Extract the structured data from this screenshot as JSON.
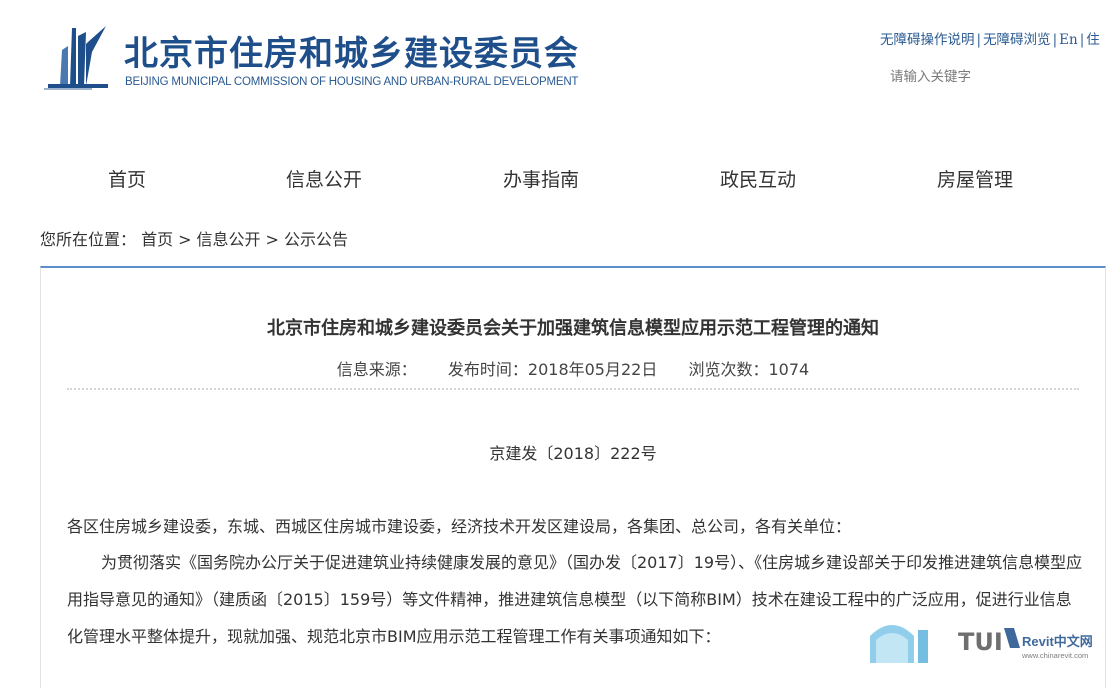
{
  "header": {
    "title": "北京市住房和城乡建设委员会",
    "subtitle": "BEIJING MUNICIPAL COMMISSION OF HOUSING AND URBAN-RURAL DEVELOPMENT",
    "links": {
      "accessibility_guide": "无障碍操作说明",
      "accessibility_browse": "无障碍浏览",
      "english": "En",
      "more": "住"
    },
    "search_placeholder": "请输入关键字"
  },
  "nav": {
    "items": [
      "首页",
      "信息公开",
      "办事指南",
      "政民互动",
      "房屋管理"
    ]
  },
  "breadcrumb": {
    "prefix": "您所在位置：",
    "items": [
      "首页",
      "信息公开",
      "公示公告"
    ],
    "separator": ">"
  },
  "article": {
    "title": "北京市住房和城乡建设委员会关于加强建筑信息模型应用示范工程管理的通知",
    "meta": {
      "source": "信息来源：",
      "date": "发布时间：2018年05月22日",
      "views": "浏览次数：1074"
    },
    "doc_number": "京建发〔2018〕222号",
    "paragraph1": "各区住房城乡建设委，东城、西城区住房城市建设委，经济技术开发区建设局，各集团、总公司，各有关单位：",
    "paragraph2": "为贯彻落实《国务院办公厅关于促进建筑业持续健康发展的意见》（国办发〔2017〕19号）、《住房城乡建设部关于印发推进建筑信息模型应用指导意见的通知》（建质函〔2015〕159号）等文件精神，推进建筑信息模型（以下简称BIM）技术在建设工程中的广泛应用，促进行业信息化管理水平整体提升，现就加强、规范北京市BIM应用示范工程管理工作有关事项通知如下："
  },
  "watermark": {
    "brand": "Revit中文网",
    "url": "www.chinarevit.com"
  },
  "colors": {
    "brand_blue": "#1f4f8a",
    "panel_border": "#5b8fc7"
  }
}
